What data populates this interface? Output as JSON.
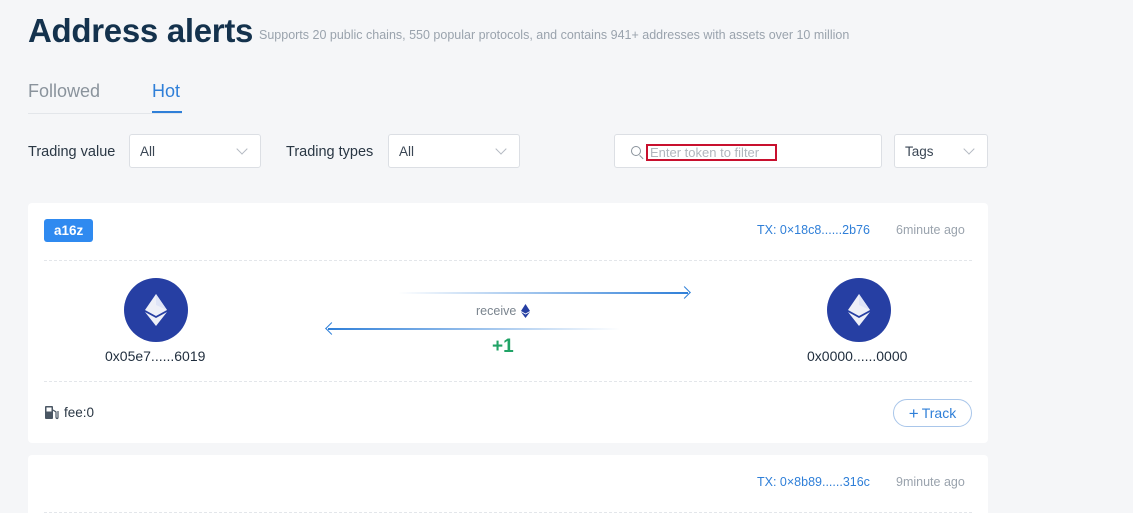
{
  "header": {
    "title": "Address alerts",
    "subtitle": "Supports 20 public chains, 550 popular protocols, and contains 941+ addresses with assets over 10 million"
  },
  "tabs": [
    {
      "label": "Followed",
      "active": false
    },
    {
      "label": "Hot",
      "active": true
    }
  ],
  "filters": {
    "trading_value": {
      "label": "Trading value",
      "selected": "All"
    },
    "trading_types": {
      "label": "Trading types",
      "selected": "All"
    },
    "search": {
      "placeholder": "Enter token to filter",
      "value": ""
    },
    "tags": {
      "selected": "Tags"
    }
  },
  "alerts": [
    {
      "tag": "a16z",
      "tx": "TX: 0×18c8......2b76",
      "time": "6minute ago",
      "from_address": "0x05e7......6019",
      "to_address": "0x0000......0000",
      "action": "receive",
      "amount": "+1",
      "fee": "fee:0",
      "track_label": "Track"
    },
    {
      "tx": "TX: 0×8b89......316c",
      "time": "9minute ago"
    }
  ],
  "colors": {
    "accent": "#2f7fd8",
    "badge": "#2f8af0",
    "eth_circle": "#263fa3",
    "positive": "#21a366",
    "highlight_box": "#c8102e"
  }
}
